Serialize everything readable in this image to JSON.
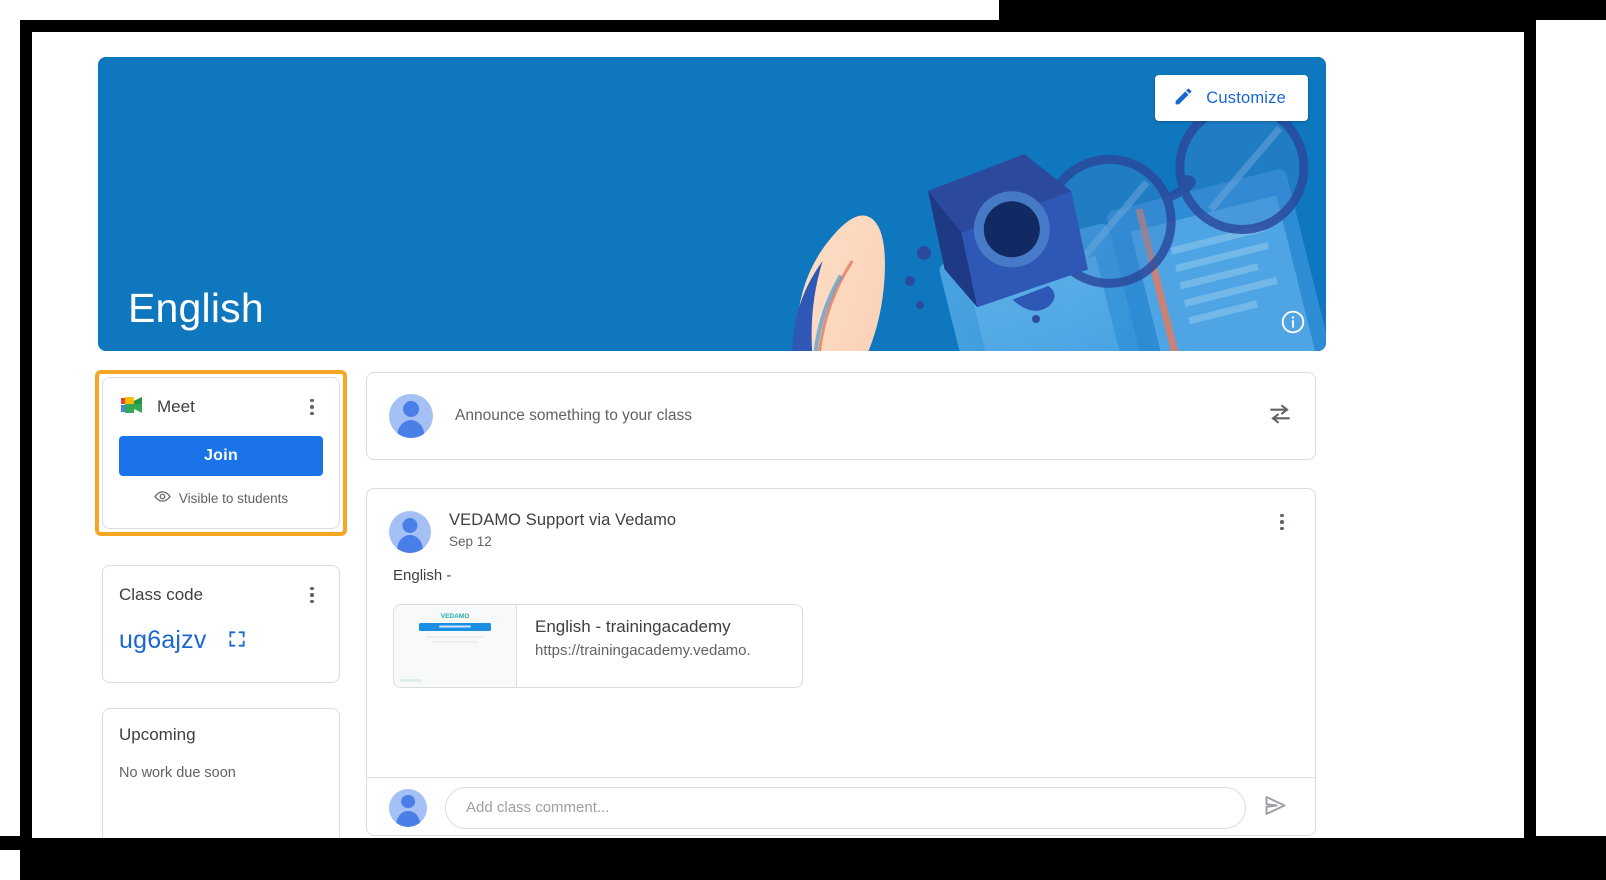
{
  "banner": {
    "class_title": "English",
    "customize_label": "Customize",
    "customize_icon": "pencil-icon",
    "info_icon": "info-circle-icon",
    "background_color": "#0f77bd",
    "accent_color": "#1967d2"
  },
  "meet_card": {
    "title": "Meet",
    "icon": "google-meet-icon",
    "overflow_icon": "more-vert-icon",
    "join_label": "Join",
    "visibility_text": "Visible to students",
    "visibility_icon": "eye-icon",
    "highlight_color": "#f5a623"
  },
  "class_code_card": {
    "title": "Class code",
    "overflow_icon": "more-vert-icon",
    "code": "ug6ajzv",
    "expand_icon": "fullscreen-icon"
  },
  "upcoming_card": {
    "title": "Upcoming",
    "empty_text": "No work due soon"
  },
  "announcement_composer": {
    "placeholder": "Announce something to your class",
    "avatar": "user-avatar",
    "share_icon": "share-arrows-icon"
  },
  "post": {
    "author": "VEDAMO Support via Vedamo",
    "date": "Sep 12",
    "body": "English -",
    "overflow_icon": "more-vert-icon",
    "avatar": "user-avatar",
    "link_preview": {
      "title": "English - trainingacademy",
      "url": "https://trainingacademy.vedamo.",
      "thumbnail_logo": "VEDAMO"
    },
    "comment": {
      "placeholder": "Add class comment...",
      "send_icon": "send-icon",
      "avatar": "user-avatar"
    }
  }
}
